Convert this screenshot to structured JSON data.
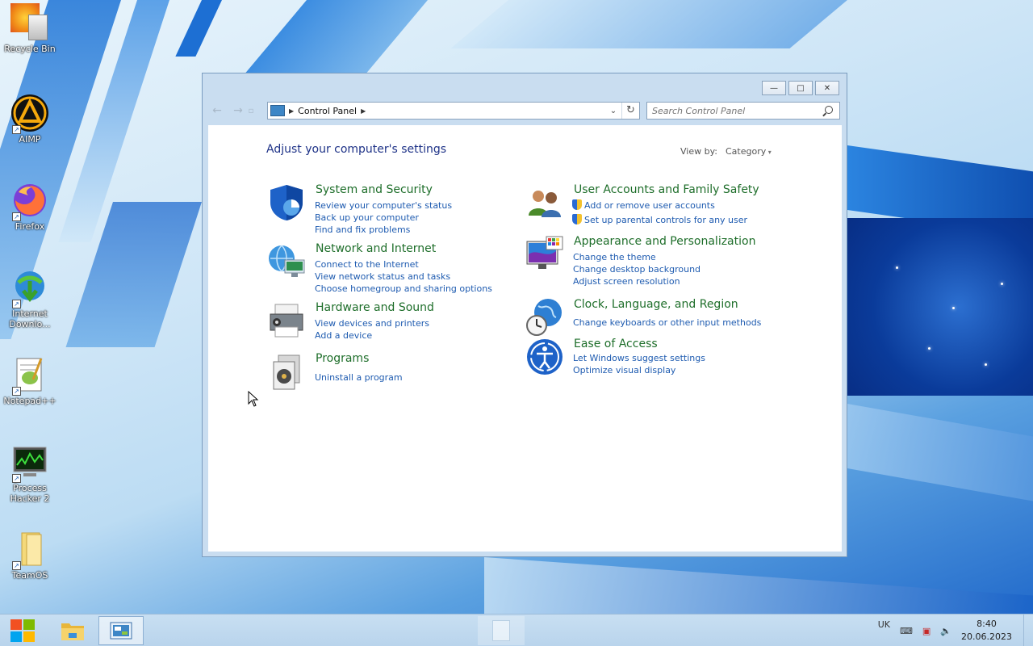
{
  "desktop": {
    "icons": [
      {
        "label": "Recycle Bin",
        "icon": "recycle-bin-icon"
      },
      {
        "label": "AIMP",
        "icon": "aimp-icon"
      },
      {
        "label": "Firefox",
        "icon": "firefox-icon"
      },
      {
        "label": "Internet Downlo...",
        "icon": "idm-icon"
      },
      {
        "label": "Notepad++",
        "icon": "notepadpp-icon"
      },
      {
        "label": "Process Hacker 2",
        "icon": "process-hacker-icon"
      },
      {
        "label": "TeamOS",
        "icon": "folder-icon"
      }
    ]
  },
  "window": {
    "address": "Control Panel",
    "search_placeholder": "Search Control Panel",
    "heading": "Adjust your computer's settings",
    "view_by_label": "View by:",
    "view_by_value": "Category",
    "categories": [
      {
        "title": "System and Security",
        "icon": "shield-icon",
        "links": [
          "Review your computer's status",
          "Back up your computer",
          "Find and fix problems"
        ]
      },
      {
        "title": "Network and Internet",
        "icon": "globe-network-icon",
        "links": [
          "Connect to the Internet",
          "View network status and tasks",
          "Choose homegroup and sharing options"
        ]
      },
      {
        "title": "Hardware and Sound",
        "icon": "printer-icon",
        "links": [
          "View devices and printers",
          "Add a device"
        ]
      },
      {
        "title": "Programs",
        "icon": "programs-icon",
        "links": [
          "Uninstall a program"
        ]
      },
      {
        "title": "User Accounts and Family Safety",
        "icon": "users-icon",
        "links": [
          "Add or remove user accounts",
          "Set up parental controls for any user"
        ]
      },
      {
        "title": "Appearance and Personalization",
        "icon": "monitor-palette-icon",
        "links": [
          "Change the theme",
          "Change desktop background",
          "Adjust screen resolution"
        ]
      },
      {
        "title": "Clock, Language, and Region",
        "icon": "clock-globe-icon",
        "links": [
          "Change keyboards or other input methods"
        ]
      },
      {
        "title": "Ease of Access",
        "icon": "ease-of-access-icon",
        "links": [
          "Let Windows suggest settings",
          "Optimize visual display"
        ]
      }
    ]
  },
  "taskbar": {
    "language": "UK",
    "time": "8:40",
    "date": "20.06.2023"
  },
  "colors": {
    "heading": "#1e3287",
    "category_title": "#1e6e2a",
    "link": "#1e5bb0"
  }
}
